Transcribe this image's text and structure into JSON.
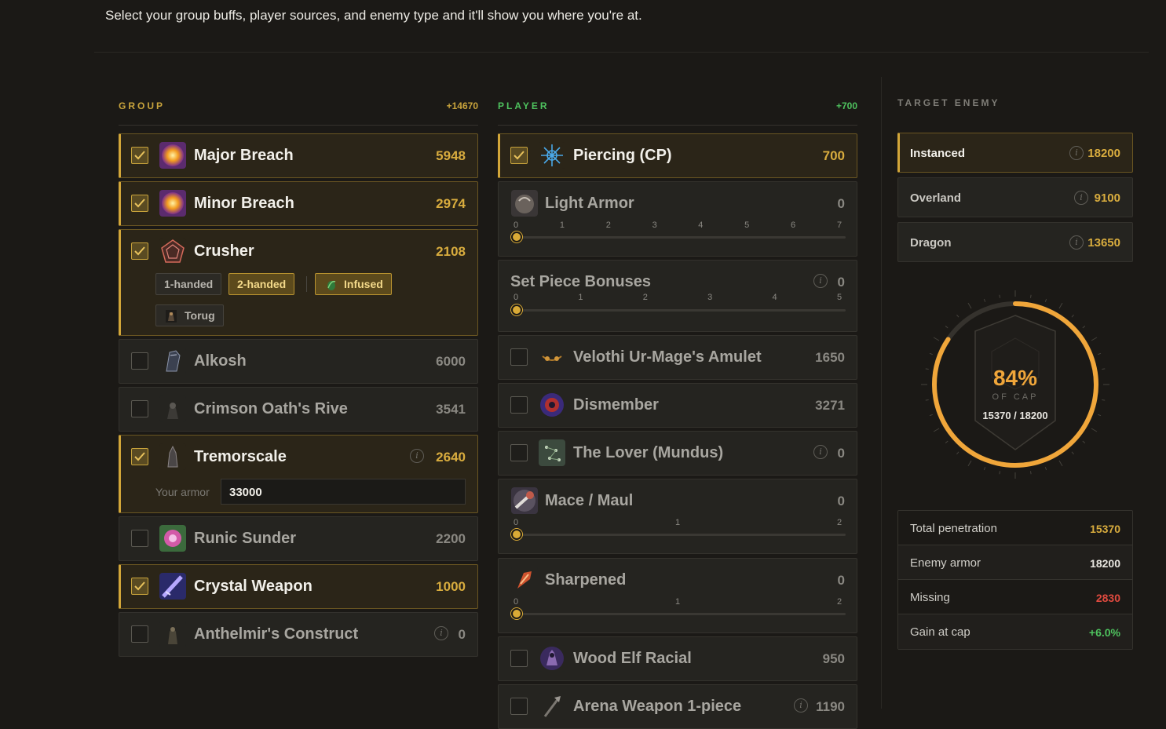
{
  "intro": "Select your group buffs, player sources, and enemy type and it'll show you where you're at.",
  "group": {
    "title": "GROUP",
    "total": "+14670",
    "items": [
      {
        "name": "Major Breach",
        "value": "5948",
        "on": true
      },
      {
        "name": "Minor Breach",
        "value": "2974",
        "on": true
      },
      {
        "name": "Crusher",
        "value": "2108",
        "on": true,
        "chips": [
          "1-handed",
          "2-handed",
          "Infused",
          "Torug"
        ]
      },
      {
        "name": "Alkosh",
        "value": "6000",
        "on": false
      },
      {
        "name": "Crimson Oath's Rive",
        "value": "3541",
        "on": false
      },
      {
        "name": "Tremorscale",
        "value": "2640",
        "on": true,
        "armor_label": "Your armor",
        "armor_value": "33000"
      },
      {
        "name": "Runic Sunder",
        "value": "2200",
        "on": false
      },
      {
        "name": "Crystal Weapon",
        "value": "1000",
        "on": true
      },
      {
        "name": "Anthelmir's Construct",
        "value": "0",
        "on": false
      }
    ]
  },
  "player": {
    "title": "PLAYER",
    "total": "+700",
    "items": [
      {
        "name": "Piercing (CP)",
        "value": "700",
        "on": true
      },
      {
        "name": "Light Armor",
        "value": "0",
        "ticks": [
          "0",
          "1",
          "2",
          "3",
          "4",
          "5",
          "6",
          "7"
        ]
      },
      {
        "name": "Set Piece Bonuses",
        "value": "0",
        "ticks": [
          "0",
          "1",
          "2",
          "3",
          "4",
          "5"
        ]
      },
      {
        "name": "Velothi Ur-Mage's Amulet",
        "value": "1650",
        "on": false
      },
      {
        "name": "Dismember",
        "value": "3271",
        "on": false
      },
      {
        "name": "The Lover (Mundus)",
        "value": "0",
        "on": false
      },
      {
        "name": "Mace / Maul",
        "value": "0",
        "ticks": [
          "0",
          "1",
          "2"
        ]
      },
      {
        "name": "Sharpened",
        "value": "0",
        "ticks": [
          "0",
          "1",
          "2"
        ]
      },
      {
        "name": "Wood Elf Racial",
        "value": "950",
        "on": false
      },
      {
        "name": "Arena Weapon 1-piece",
        "value": "1190",
        "on": false
      }
    ]
  },
  "target": {
    "title": "TARGET ENEMY",
    "enemies": [
      {
        "name": "Instanced",
        "value": "18200",
        "on": true
      },
      {
        "name": "Overland",
        "value": "9100",
        "on": false
      },
      {
        "name": "Dragon",
        "value": "13650",
        "on": false
      }
    ],
    "gauge": {
      "percent_label": "84%",
      "of_cap": "OF CAP",
      "fraction": "15370 / 18200",
      "fill_fraction": 0.844
    },
    "stats": [
      {
        "label": "Total penetration",
        "value": "15370",
        "color": "#d8ac3e"
      },
      {
        "label": "Enemy armor",
        "value": "18200",
        "color": "#e8e6e0"
      },
      {
        "label": "Missing",
        "value": "2830",
        "color": "#e04a3f"
      },
      {
        "label": "Gain at cap",
        "value": "+6.0%",
        "color": "#4ec25e"
      }
    ]
  },
  "colors": {
    "accent": "#d2a639",
    "player": "#4ec25e",
    "gauge": "#f0a63a"
  }
}
